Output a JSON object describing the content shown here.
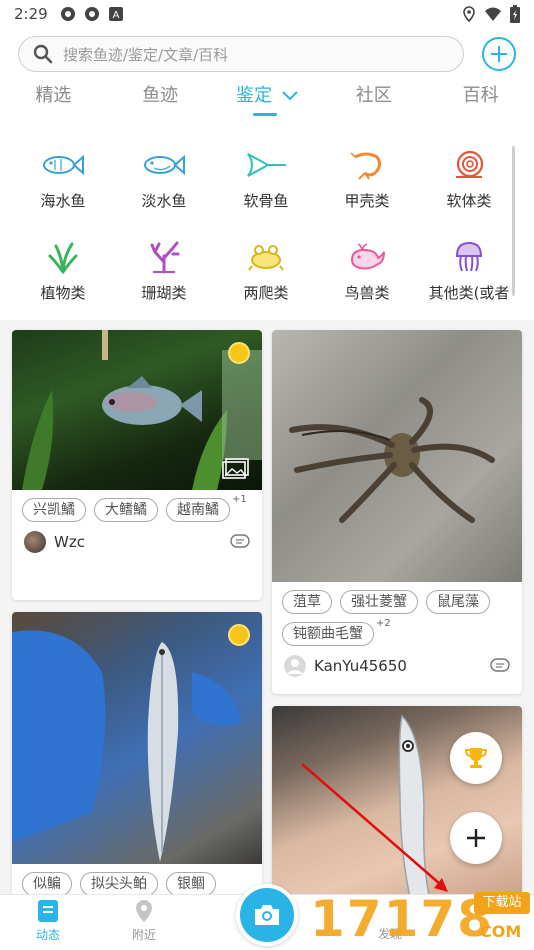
{
  "status_bar": {
    "time": "2:29"
  },
  "search": {
    "placeholder": "搜索鱼迹/鉴定/文章/百科"
  },
  "tabs": [
    {
      "label": "精选",
      "active": false
    },
    {
      "label": "鱼迹",
      "active": false
    },
    {
      "label": "鉴定",
      "active": true
    },
    {
      "label": "社区",
      "active": false
    },
    {
      "label": "百科",
      "active": false
    }
  ],
  "categories": [
    {
      "label": "海水鱼",
      "icon": "fish-icon",
      "color": "#3aa0d8"
    },
    {
      "label": "淡水鱼",
      "icon": "fish-icon",
      "color": "#3aa0d8"
    },
    {
      "label": "软骨鱼",
      "icon": "ray-icon",
      "color": "#2ec4b0"
    },
    {
      "label": "甲壳类",
      "icon": "shrimp-icon",
      "color": "#f08a2c"
    },
    {
      "label": "软体类",
      "icon": "snail-icon",
      "color": "#e5533d"
    },
    {
      "label": "植物类",
      "icon": "plant-icon",
      "color": "#3bb35a"
    },
    {
      "label": "珊瑚类",
      "icon": "coral-icon",
      "color": "#b04ec4"
    },
    {
      "label": "两爬类",
      "icon": "frog-icon",
      "color": "#d8b718"
    },
    {
      "label": "鸟兽类",
      "icon": "whale-icon",
      "color": "#e55b9b"
    },
    {
      "label": "其他类(或者",
      "icon": "jellyfish-icon",
      "color": "#8a4fd0"
    }
  ],
  "cards": [
    {
      "tags": [
        "兴凯鱊",
        "大鳍鱊",
        "越南鱊"
      ],
      "extra": "+1",
      "author": "Wzc"
    },
    {
      "tags": [
        "菹草",
        "强壮菱蟹",
        "鼠尾藻",
        "钝额曲毛蟹"
      ],
      "extra": "+2",
      "author": "KanYu45650"
    },
    {
      "tags": [
        "似鳊",
        "拟尖头鲌",
        "银鲴"
      ],
      "extra": "",
      "author": ""
    }
  ],
  "bottom_nav": [
    {
      "label": "动态",
      "active": true
    },
    {
      "label": "附近",
      "active": false
    },
    {
      "label": "发现",
      "active": false
    }
  ],
  "watermark": {
    "text": "17178",
    "badge": "下载站",
    "domain": "COM"
  },
  "colors": {
    "accent": "#2ab4e6",
    "coin": "#f5c518",
    "watermark": "#f2a31a"
  }
}
